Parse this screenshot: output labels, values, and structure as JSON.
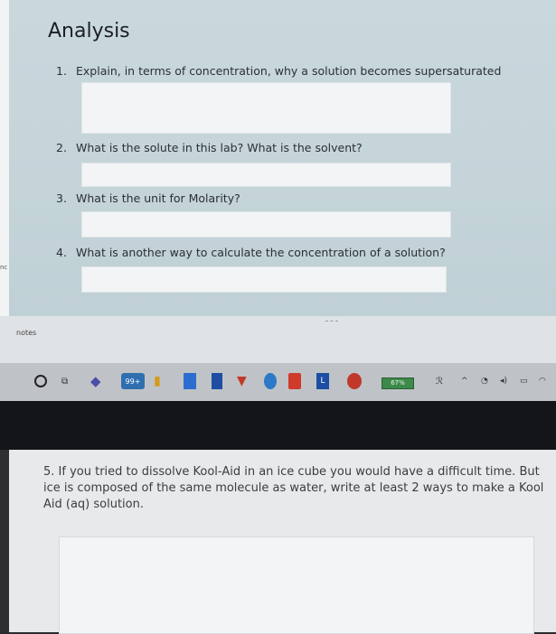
{
  "slide": {
    "title": "Analysis",
    "side_label": "nc",
    "questions": [
      {
        "num": "1.",
        "text": "Explain, in terms of concentration, why a solution becomes supersaturated"
      },
      {
        "num": "2.",
        "text": "What is the solute in this lab? What is the solvent?"
      },
      {
        "num": "3.",
        "text": "What is the unit for Molarity?"
      },
      {
        "num": "4.",
        "text": "What is another way to calculate the concentration of a solution?"
      }
    ]
  },
  "notes": {
    "label": "notes"
  },
  "taskbar": {
    "badge_count": "99+",
    "battery_label": "67%",
    "apps": [
      "search-icon",
      "task-view-icon",
      "teams-icon",
      "mail-icon",
      "file-explorer-icon",
      "word-icon",
      "store-icon",
      "brave-icon",
      "chrome-icon",
      "office-icon",
      "lens-icon",
      "record-icon"
    ]
  },
  "document": {
    "question": "5. If you tried to dissolve Kool-Aid in an ice cube you would have a difficult time. But ice is composed of the same molecule as water, write at least 2 ways to make a Kool Aid (aq) solution."
  }
}
